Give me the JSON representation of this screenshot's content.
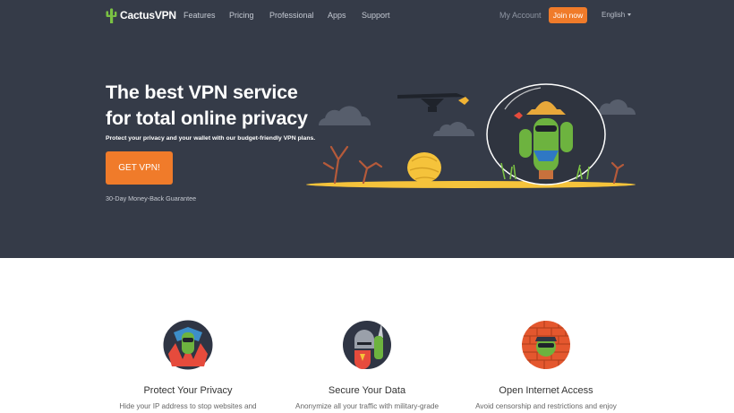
{
  "nav": {
    "logo": {
      "cactus": "Cactus",
      "vpn": "VPN"
    },
    "links": [
      "Features",
      "Pricing",
      "Professional",
      "Apps",
      "Support"
    ],
    "my_account": "My Account",
    "join_label": "Join now",
    "language": "English"
  },
  "hero": {
    "title_line1": "The best VPN service",
    "title_line2": "for total online privacy",
    "subtitle": "Protect your privacy and your wallet with our budget-friendly VPN plans.",
    "cta_label": "GET VPN!",
    "guarantee": "30-Day Money-Back Guarantee"
  },
  "features": [
    {
      "title": "Protect Your Privacy",
      "desc": "Hide your IP address to stop websites and"
    },
    {
      "title": "Secure Your Data",
      "desc": "Anonymize all your traffic with military-grade"
    },
    {
      "title": "Open Internet Access",
      "desc": "Avoid censorship and restrictions and enjoy"
    }
  ],
  "colors": {
    "hero_bg": "#353b48",
    "accent_orange": "#f07b2a",
    "cactus_green": "#6db33f",
    "sand_yellow": "#f5c33b"
  }
}
